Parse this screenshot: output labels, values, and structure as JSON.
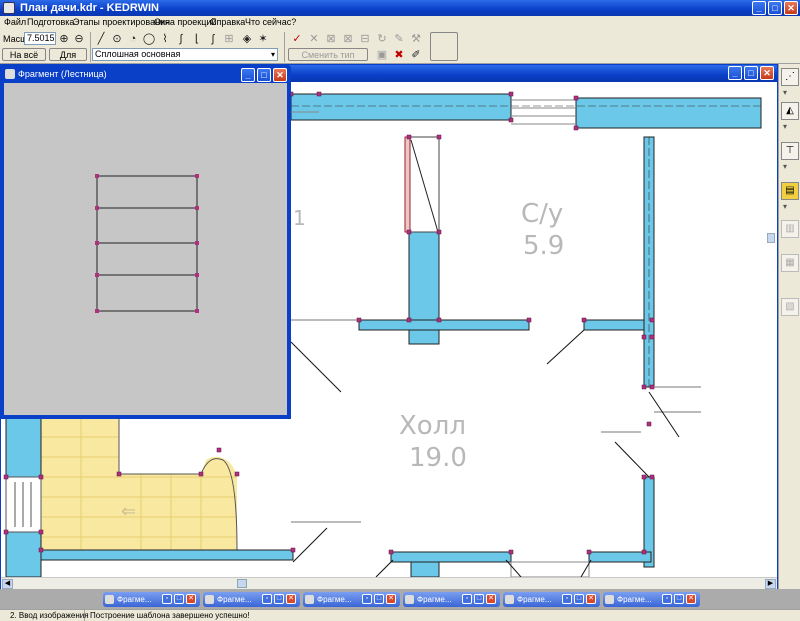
{
  "window": {
    "title": "План дачи.kdr - KEDRWIN"
  },
  "menu": [
    "Файл",
    "Подготовка",
    "Этапы проектирования",
    "Окна проекций",
    "Справка",
    "Что сейчас?"
  ],
  "toolbar": {
    "scale_label": "Масшт",
    "scale_value": "7.5015",
    "fit_button": "На всё окно",
    "all_button": "Для всех",
    "line_type": "Сплошная основная",
    "change_line_type": "Сменить тип линии"
  },
  "fragment": {
    "title": "Фрагмент (Лестница)"
  },
  "plan": {
    "room1_name": "С/у",
    "room1_area": "5.9",
    "room2_name": "Холл",
    "room2_area": "19.0",
    "left_partial": "1"
  },
  "taskbar": [
    "Фрагме...",
    "Фрагме...",
    "Фрагме...",
    "Фрагме...",
    "Фрагме...",
    "Фрагме..."
  ],
  "status": {
    "mode": "2. Ввод изображения",
    "message": "Построение шаблона завершено успешно!"
  },
  "colors": {
    "wall_fill": "#6cc8e8",
    "stair_fill": "#f8e8a0",
    "title_blue": "#0a3fc8"
  }
}
